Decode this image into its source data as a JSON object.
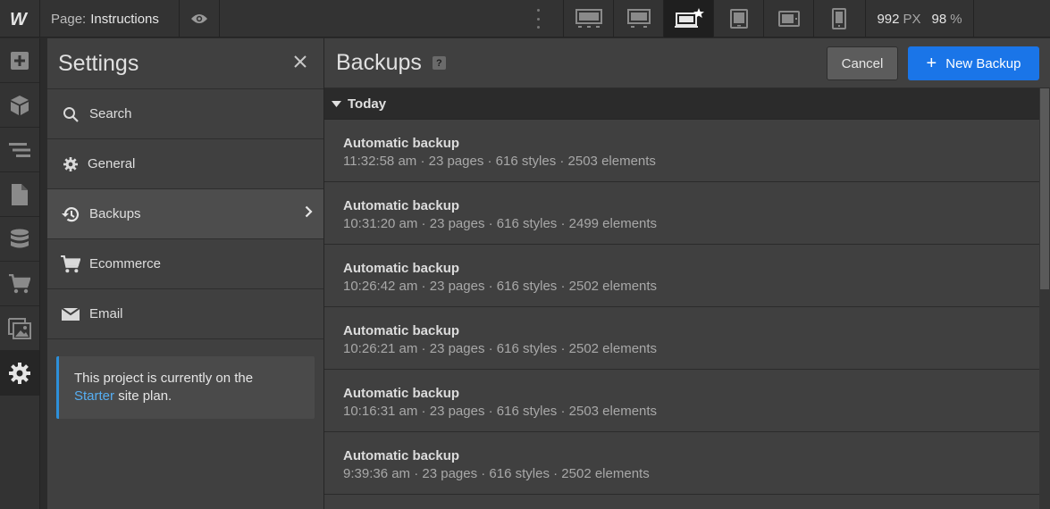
{
  "topbar": {
    "page_label": "Page:",
    "page_name": "Instructions",
    "width_value": "992",
    "width_unit": "PX",
    "zoom_value": "98",
    "zoom_unit": "%"
  },
  "settings": {
    "title": "Settings",
    "items": [
      {
        "label": "Search"
      },
      {
        "label": "General"
      },
      {
        "label": "Backups"
      },
      {
        "label": "Ecommerce"
      },
      {
        "label": "Email"
      }
    ],
    "plan_text_1": "This project is currently on the",
    "plan_link": "Starter",
    "plan_text_2": "site plan."
  },
  "main": {
    "title": "Backups",
    "help": "?",
    "cancel_label": "Cancel",
    "new_backup_label": "New Backup",
    "group_label": "Today",
    "backups": [
      {
        "title": "Automatic backup",
        "meta": "11:32:58 am · 23 pages · 616 styles · 2503 elements"
      },
      {
        "title": "Automatic backup",
        "meta": "10:31:20 am · 23 pages · 616 styles · 2499 elements"
      },
      {
        "title": "Automatic backup",
        "meta": "10:26:42 am · 23 pages · 616 styles · 2502 elements"
      },
      {
        "title": "Automatic backup",
        "meta": "10:26:21 am · 23 pages · 616 styles · 2502 elements"
      },
      {
        "title": "Automatic backup",
        "meta": "10:16:31 am · 23 pages · 616 styles · 2503 elements"
      },
      {
        "title": "Automatic backup",
        "meta": "9:39:36 am · 23 pages · 616 styles · 2502 elements"
      }
    ]
  },
  "colors": {
    "accent": "#1a75e8",
    "link": "#56aef2",
    "panel": "#404040"
  }
}
